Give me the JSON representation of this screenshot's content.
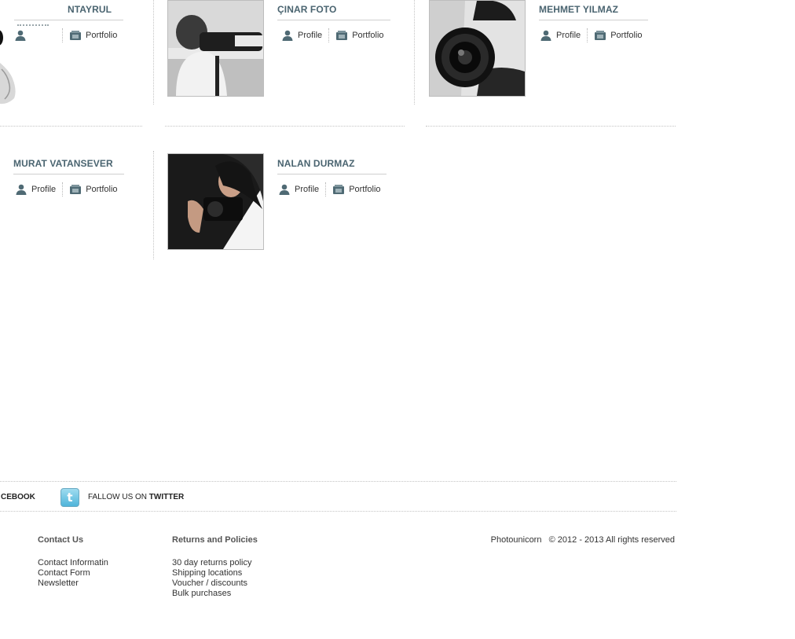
{
  "photographers": [
    {
      "name": "NTAYRUL",
      "profile_label": "",
      "portfolio_label": "Portfolio"
    },
    {
      "name": "ÇINAR FOTO",
      "profile_label": "Profile",
      "portfolio_label": "Portfolio"
    },
    {
      "name": "MEHMET YILMAZ",
      "profile_label": "Profile",
      "portfolio_label": "Portfolio"
    },
    {
      "name": "MURAT VATANSEVER",
      "profile_label": "Profile",
      "portfolio_label": "Portfolio"
    },
    {
      "name": "NALAN DURMAZ",
      "profile_label": "Profile",
      "portfolio_label": "Portfolio"
    }
  ],
  "icons": {
    "profile": "user-icon",
    "portfolio": "portfolio-icon",
    "twitter": "twitter-icon"
  },
  "social": {
    "facebook_label": "CEBOOK",
    "twitter_prefix": "FALLOW US ON",
    "twitter_label": "TWITTER"
  },
  "footer": {
    "contact": {
      "heading": "Contact Us",
      "links": [
        "Contact Informatin",
        "Contact Form",
        "Newsletter"
      ]
    },
    "returns": {
      "heading": "Returns and Policies",
      "links": [
        "30 day returns policy",
        "Shipping locations",
        "Voucher / discounts",
        "Bulk purchases"
      ]
    },
    "brand": "Photounicorn",
    "copyright": "© 2012 - 2013 All rights reserved"
  },
  "colors": {
    "name_text": "#4a6470",
    "icon": "#4f6a74",
    "twitter_blue": "#4fb4da"
  }
}
